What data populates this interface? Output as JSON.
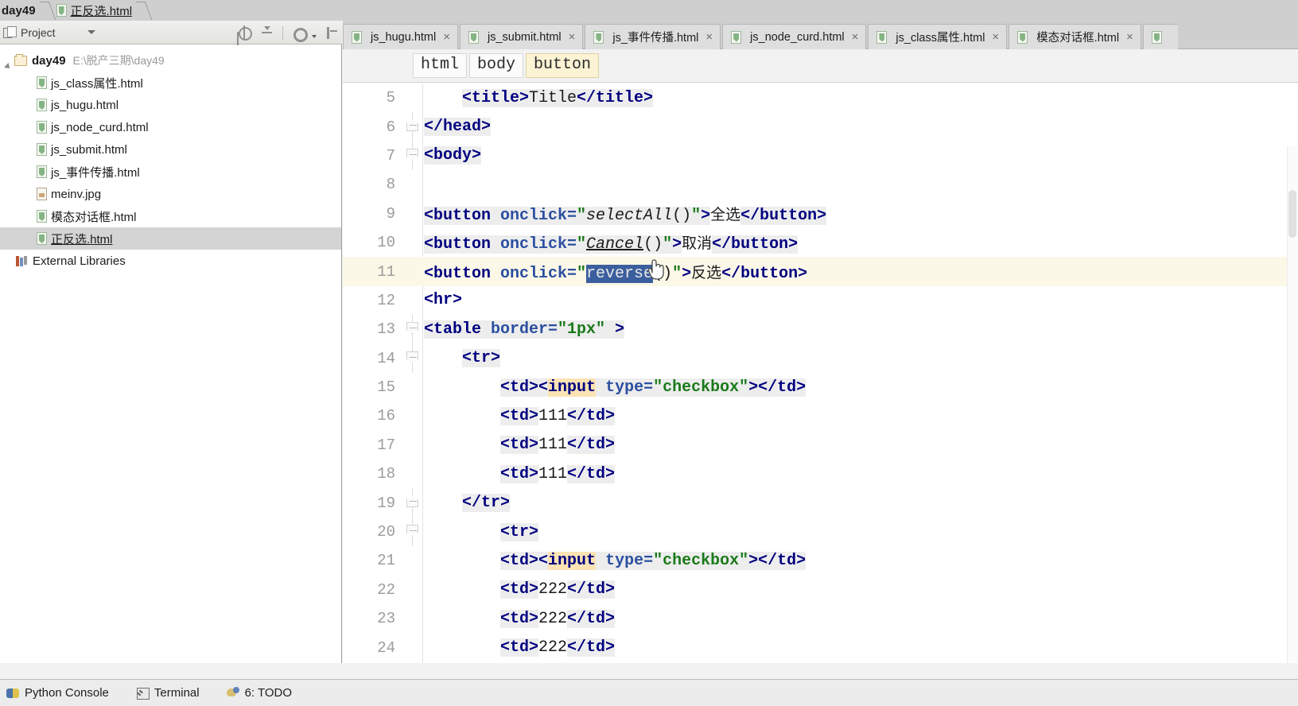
{
  "breadcrumb": {
    "project": "day49",
    "file": "正反选.html",
    "file_icon": "html-file-icon"
  },
  "project_panel": {
    "title": "Project",
    "window_icon": "project-window-icon",
    "dropdown_icon": "chevron-down-icon",
    "tools": [
      {
        "name": "locate-icon",
        "label": "Select Opened File"
      },
      {
        "name": "collapse-all-icon",
        "label": "Collapse All"
      },
      {
        "name": "gear-icon",
        "label": "Settings"
      },
      {
        "name": "hide-panel-icon",
        "label": "Hide"
      }
    ],
    "tree": [
      {
        "name": "day49",
        "path": "E:\\脱产三期\\day49",
        "type": "folder",
        "bold": true,
        "selected": false,
        "depth": 0
      },
      {
        "name": "js_class属性.html",
        "type": "html",
        "selected": false,
        "depth": 1
      },
      {
        "name": "js_hugu.html",
        "type": "html",
        "selected": false,
        "depth": 1
      },
      {
        "name": "js_node_curd.html",
        "type": "html",
        "selected": false,
        "depth": 1
      },
      {
        "name": "js_submit.html",
        "type": "html",
        "selected": false,
        "depth": 1
      },
      {
        "name": "js_事件传播.html",
        "type": "html",
        "selected": false,
        "depth": 1
      },
      {
        "name": "meinv.jpg",
        "type": "image",
        "selected": false,
        "depth": 1
      },
      {
        "name": "模态对话框.html",
        "type": "html",
        "selected": false,
        "depth": 1
      },
      {
        "name": "正反选.html",
        "type": "html",
        "selected": true,
        "depth": 1
      },
      {
        "name": "External Libraries",
        "type": "library",
        "selected": false,
        "depth": 0
      }
    ]
  },
  "editor": {
    "tabs": [
      {
        "label": "js_hugu.html",
        "icon": "html-file-icon",
        "close": "×",
        "active": false
      },
      {
        "label": "js_submit.html",
        "icon": "html-file-icon",
        "close": "×",
        "active": false
      },
      {
        "label": "js_事件传播.html",
        "icon": "html-file-icon",
        "close": "×",
        "active": false
      },
      {
        "label": "js_node_curd.html",
        "icon": "html-file-icon",
        "close": "×",
        "active": false
      },
      {
        "label": "js_class属性.html",
        "icon": "html-file-icon",
        "close": "×",
        "active": false
      },
      {
        "label": "模态对话框.html",
        "icon": "html-file-icon",
        "close": "×",
        "active": false
      },
      {
        "label": "",
        "icon": "html-file-icon",
        "close": "",
        "active": false
      }
    ],
    "structure_breadcrumb": [
      {
        "label": "html",
        "active": false
      },
      {
        "label": "body",
        "active": false
      },
      {
        "label": "button",
        "active": true
      }
    ],
    "selected_text": "reverse",
    "hover_link_text": "Cancel",
    "current_line": 11,
    "lines": [
      {
        "n": "5",
        "fold": "none",
        "indent": 4
      },
      {
        "n": "6",
        "fold": "up",
        "indent": 1
      },
      {
        "n": "7",
        "fold": "dn",
        "indent": 1
      },
      {
        "n": "8",
        "fold": "none",
        "indent": 1
      },
      {
        "n": "9",
        "fold": "none",
        "indent": 1
      },
      {
        "n": "10",
        "fold": "none",
        "indent": 1
      },
      {
        "n": "11",
        "fold": "none",
        "indent": 1
      },
      {
        "n": "12",
        "fold": "none",
        "indent": 1
      },
      {
        "n": "13",
        "fold": "dn",
        "indent": 1
      },
      {
        "n": "14",
        "fold": "dn",
        "indent": 2
      },
      {
        "n": "15",
        "fold": "none",
        "indent": 3
      },
      {
        "n": "16",
        "fold": "none",
        "indent": 3
      },
      {
        "n": "17",
        "fold": "none",
        "indent": 3
      },
      {
        "n": "18",
        "fold": "none",
        "indent": 3
      },
      {
        "n": "19",
        "fold": "up",
        "indent": 2
      },
      {
        "n": "20",
        "fold": "dn",
        "indent": 3
      },
      {
        "n": "21",
        "fold": "none",
        "indent": 3
      },
      {
        "n": "22",
        "fold": "none",
        "indent": 3
      },
      {
        "n": "23",
        "fold": "none",
        "indent": 3
      },
      {
        "n": "24",
        "fold": "none",
        "indent": 3
      }
    ],
    "code_text": [
      "    <title>Title</title>",
      "</head>",
      "<body>",
      "",
      "<button onclick=\"selectAll()\">全选</button>",
      "<button onclick=\"Cancel()\">取消</button>",
      "<button onclick=\"reverse()\">反选</button>",
      "<hr>",
      "<table border=\"1px\" >",
      "    <tr>",
      "        <td><input type=\"checkbox\"></td>",
      "        <td>111</td>",
      "        <td>111</td>",
      "        <td>111</td>",
      "    </tr>",
      "        <tr>",
      "        <td><input type=\"checkbox\"></td>",
      "        <td>222</td>",
      "        <td>222</td>",
      "        <td>222</td>"
    ]
  },
  "statusbar": {
    "items": [
      {
        "label": "Python Console",
        "icon": "python-icon"
      },
      {
        "label": "Terminal",
        "icon": "terminal-icon"
      },
      {
        "label": "6: TODO",
        "icon": "todo-icon"
      }
    ]
  },
  "colors": {
    "tag": "#000080",
    "attribute": "#2b4fa0",
    "string": "#1a7a1a",
    "selection": "#3b5e9e",
    "current_line": "#fcf8e8",
    "breadcrumb_active": "#fbf3d4",
    "panel_bg": "#cfcfcf"
  }
}
